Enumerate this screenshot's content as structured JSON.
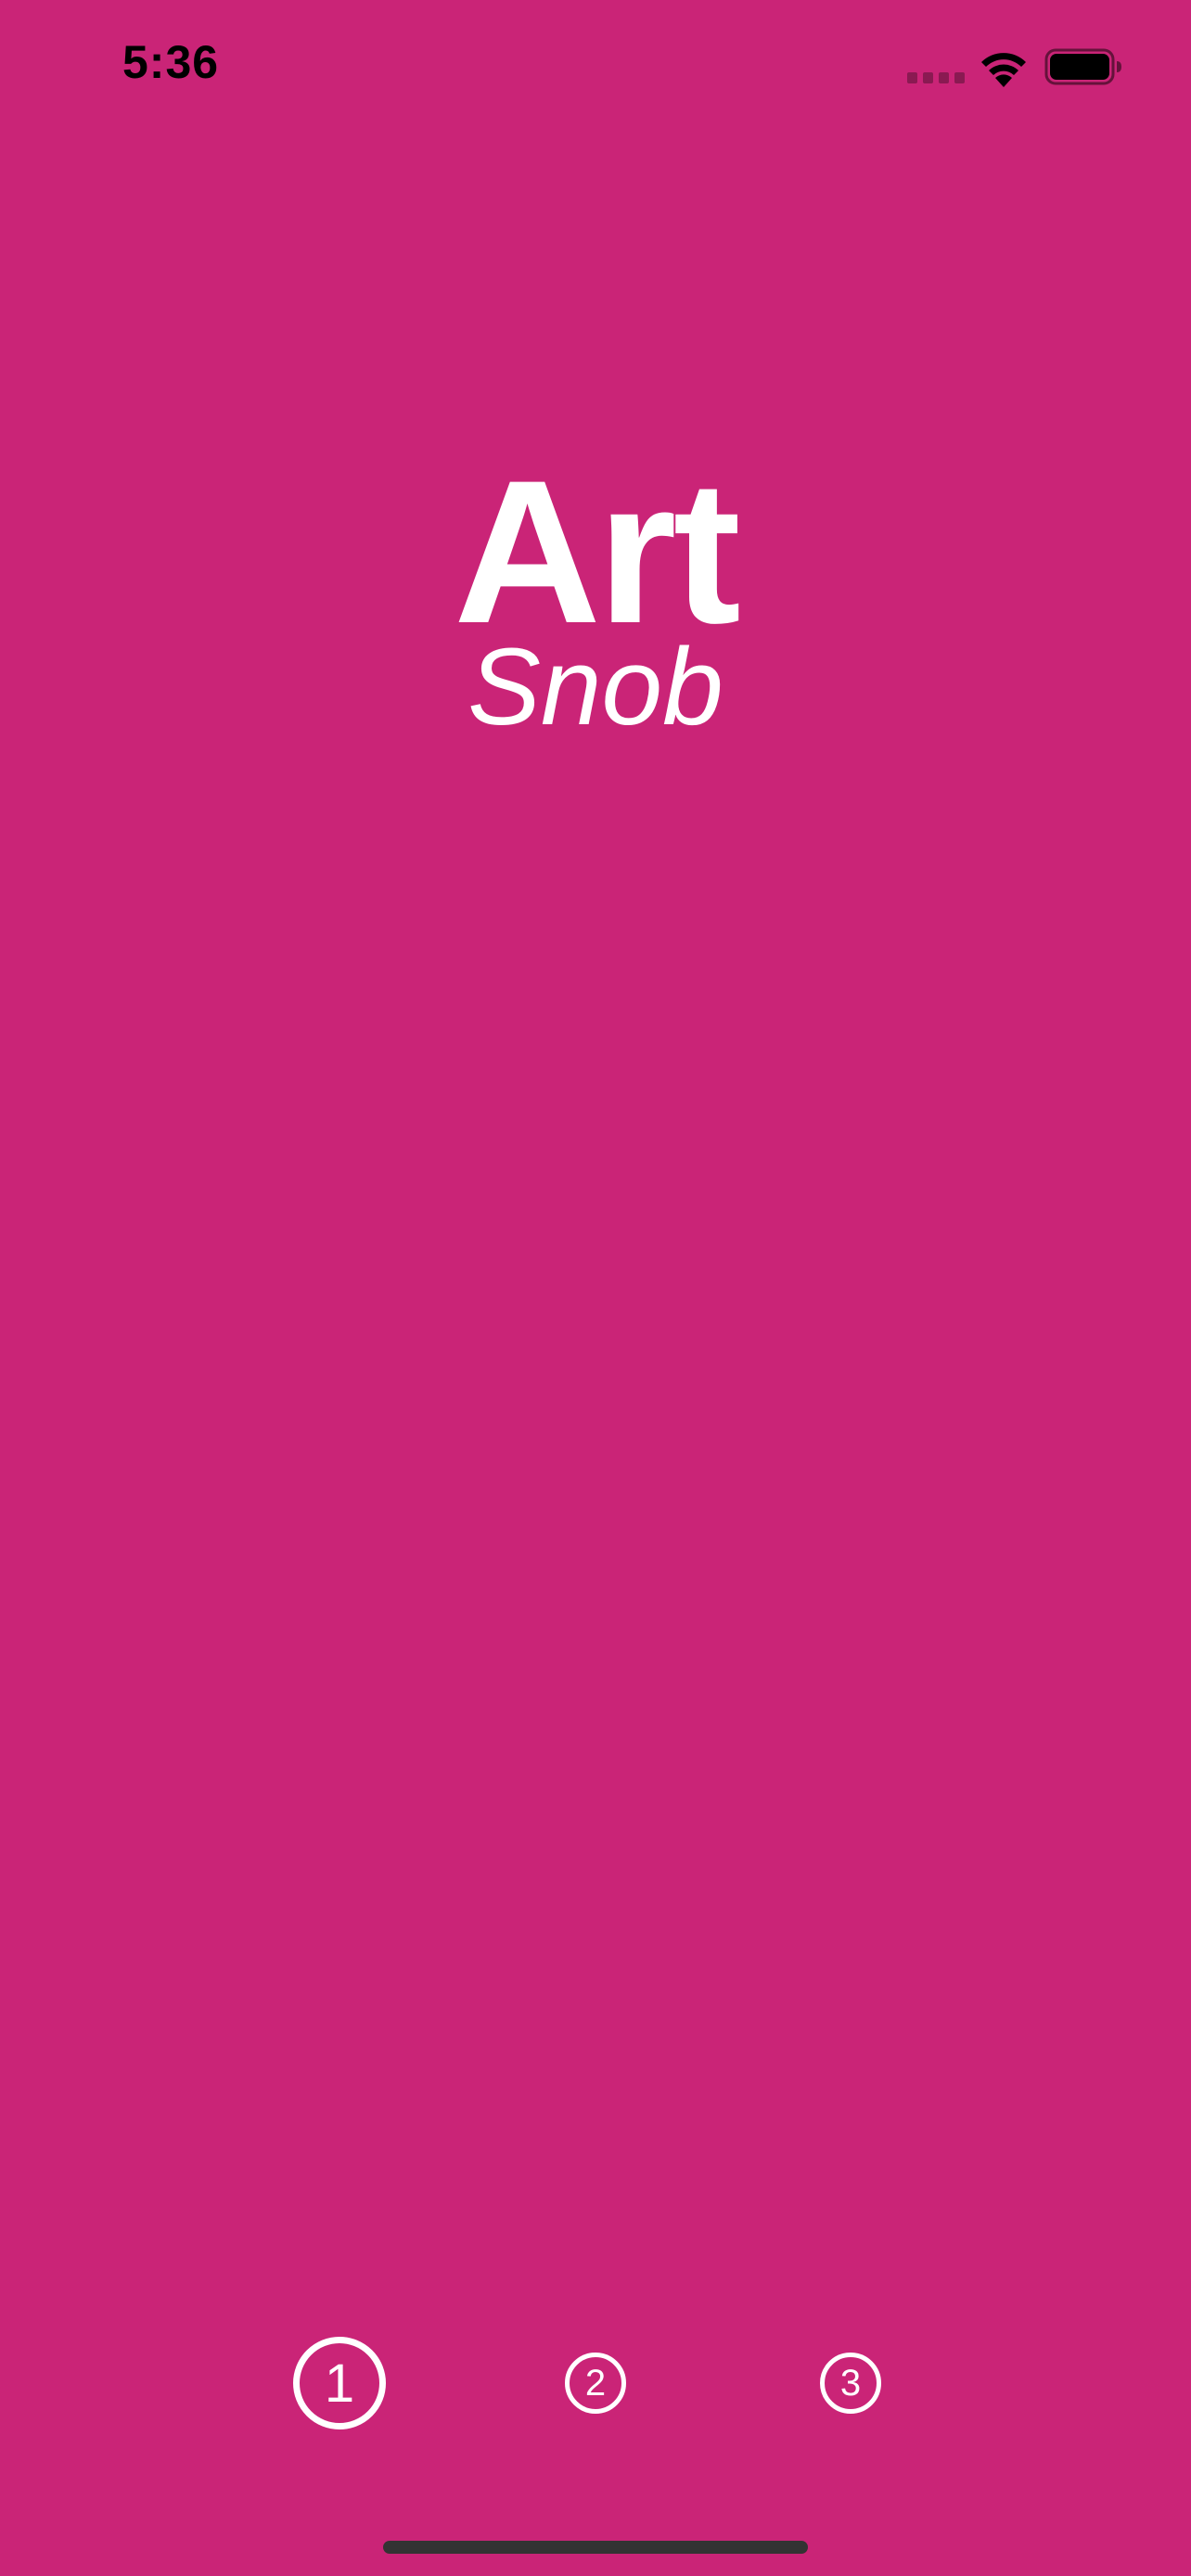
{
  "status_bar": {
    "time": "5:36",
    "icons": [
      "cellular-signal-icon",
      "wifi-icon",
      "battery-icon"
    ]
  },
  "logo": {
    "line1": "Art",
    "line2": "Snob"
  },
  "pager": {
    "pages": [
      "1",
      "2",
      "3"
    ],
    "active_index": 0
  },
  "colors": {
    "background": "#CA2477",
    "foreground": "#FFFFFF",
    "status_text": "#000000"
  }
}
